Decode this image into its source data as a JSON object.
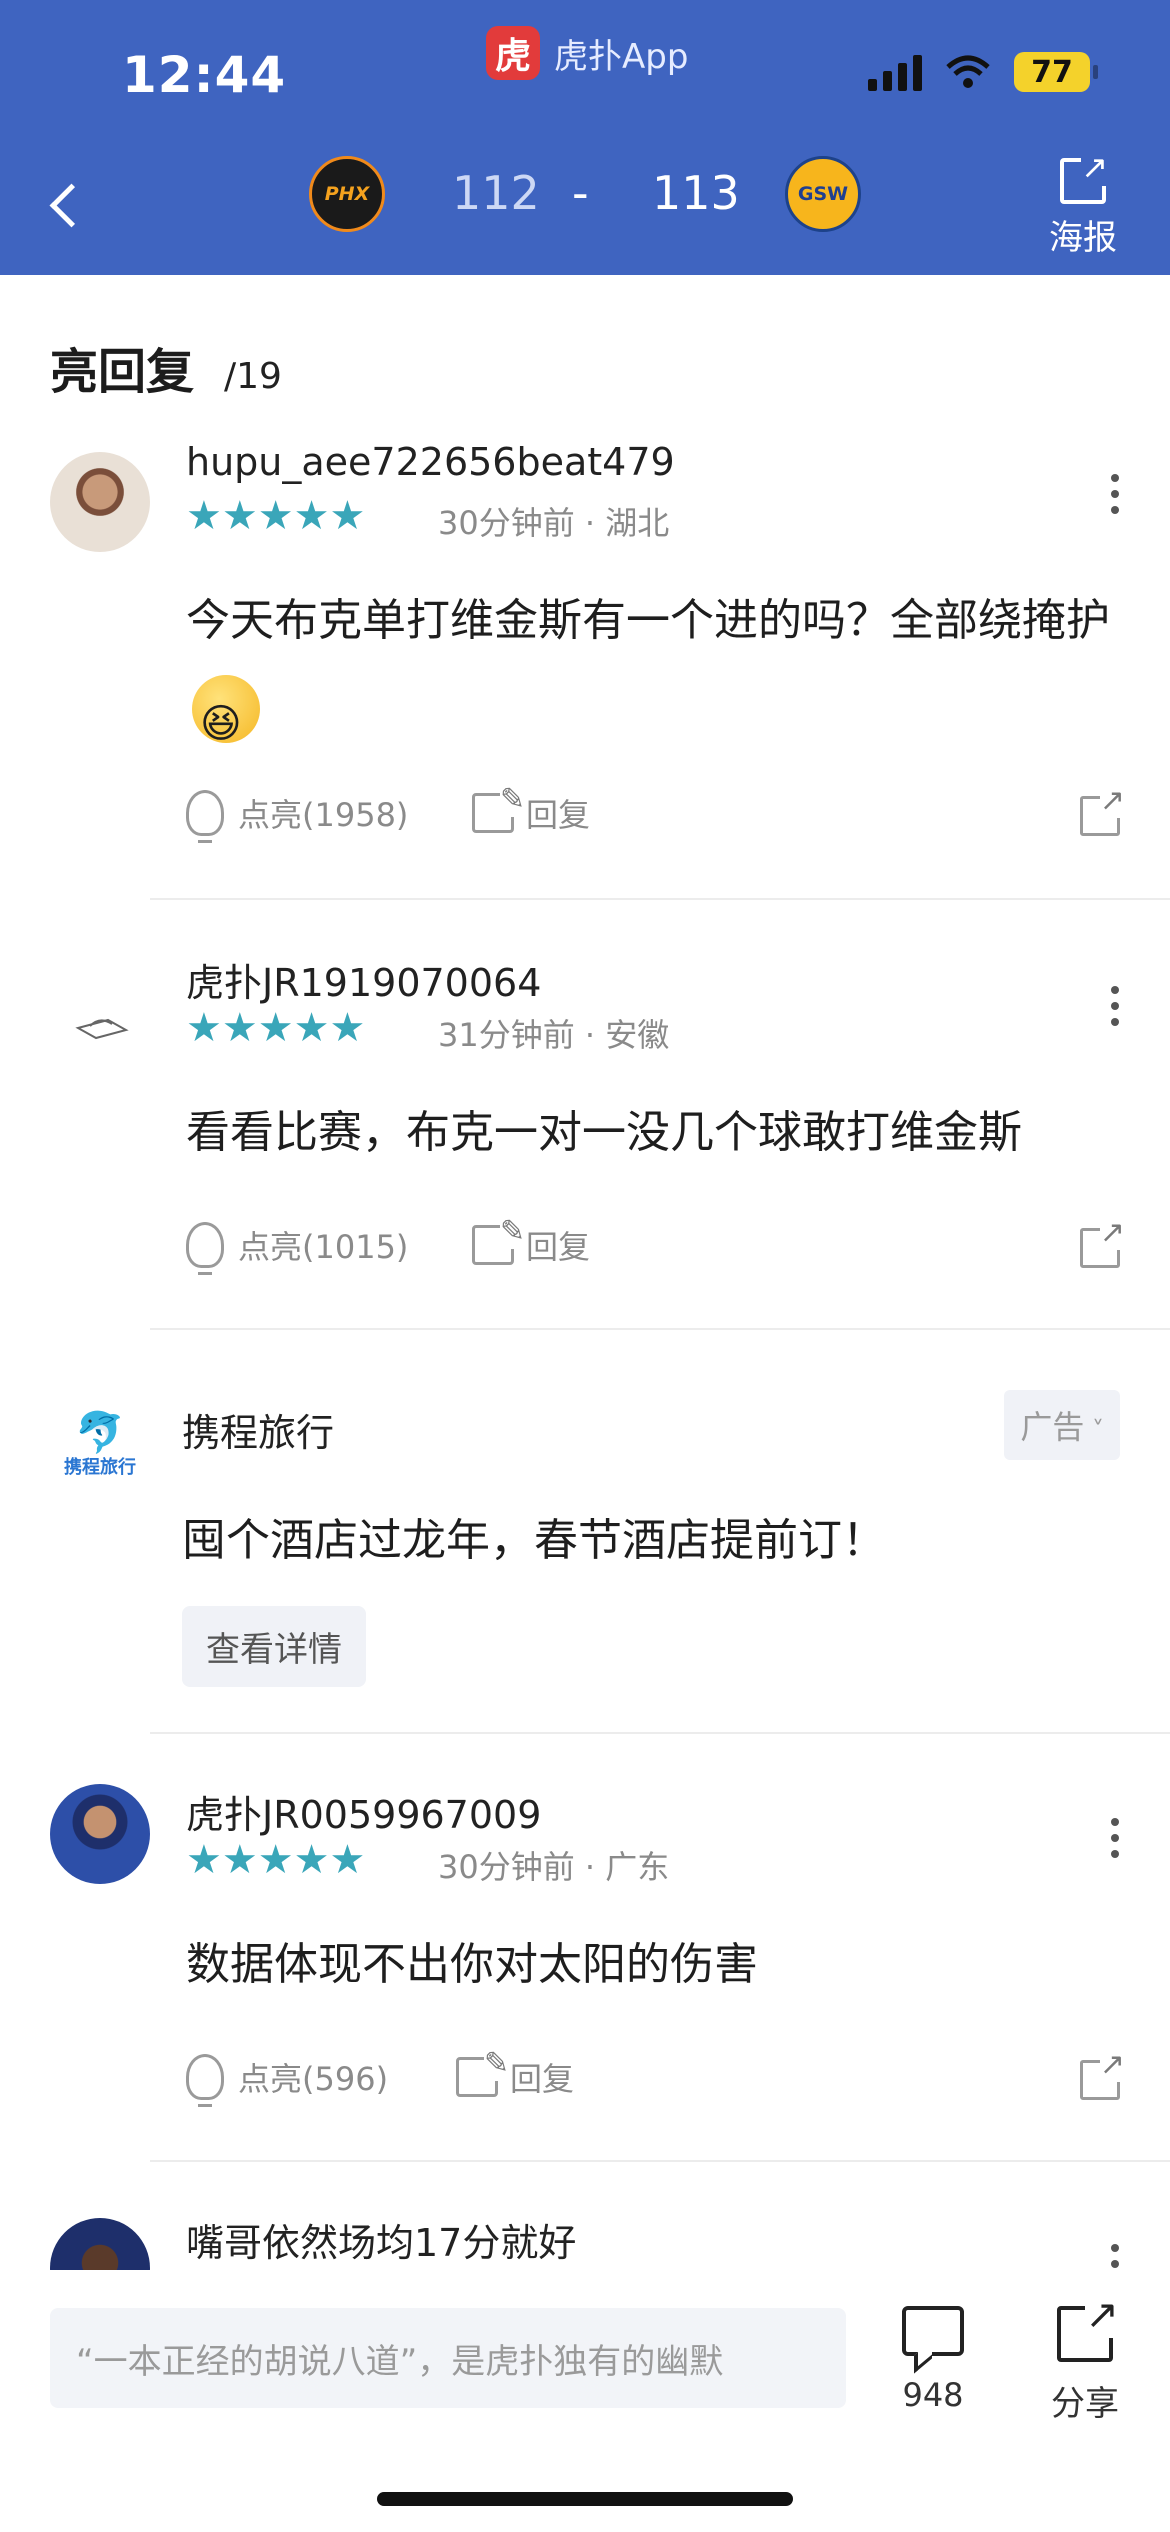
{
  "status": {
    "time": "12:44",
    "app_name": "虎扑App",
    "app_logo_char": "虎",
    "battery": "77"
  },
  "game": {
    "home_team": "PHX",
    "away_team": "GSW",
    "home_score": "112",
    "dash": "-",
    "away_score": "113",
    "poster_label": "海报"
  },
  "section": {
    "title": "亮回复",
    "count": "/19"
  },
  "comments": [
    {
      "username": "hupu_aee722656beat479",
      "time_location": "30分钟前 · 湖北",
      "text": "今天布克单打维金斯有一个进的吗？全部绕掩护",
      "like_label": "点亮(1958)",
      "reply_label": "回复",
      "stars": "★★★★★"
    },
    {
      "username": "虎扑JR1919070064",
      "time_location": "31分钟前 · 安徽",
      "text": "看看比赛，布克一对一没几个球敢打维金斯",
      "like_label": "点亮(1015)",
      "reply_label": "回复",
      "stars": "★★★★★"
    },
    {
      "username": "虎扑JR0059967009",
      "time_location": "30分钟前 · 广东",
      "text": "数据体现不出你对太阳的伤害",
      "like_label": "点亮(596)",
      "reply_label": "回复",
      "stars": "★★★★★"
    },
    {
      "username": "嘴哥依然场均17分就好"
    }
  ],
  "ad": {
    "name": "携程旅行",
    "tag": "广告",
    "text": "囤个酒店过龙年，春节酒店提前订！",
    "button": "查看详情",
    "logo_text": "携程旅行"
  },
  "bottom": {
    "input_placeholder": "“一本正经的胡说八道”，是虎扑独有的幽默",
    "comment_count": "948",
    "share_label": "分享"
  }
}
